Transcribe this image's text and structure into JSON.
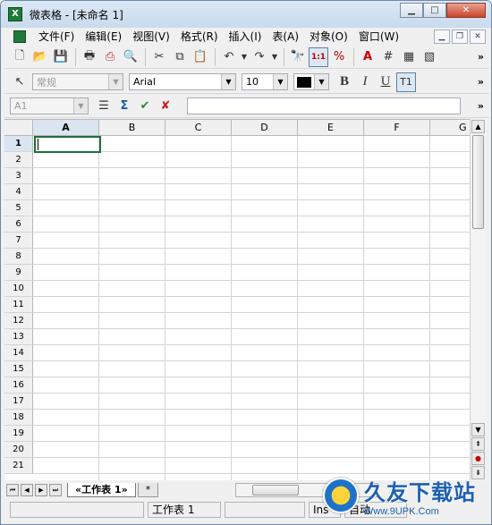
{
  "window": {
    "title": "微表格 - [未命名 1]"
  },
  "menu": [
    "文件(F)",
    "编辑(E)",
    "视图(V)",
    "格式(R)",
    "插入(I)",
    "表(A)",
    "对象(O)",
    "窗口(W)"
  ],
  "format_toolbar": {
    "style": "常规",
    "font": "Arial",
    "size": "10"
  },
  "formula_bar": {
    "cell_ref": "A1",
    "formula": ""
  },
  "columns": [
    "A",
    "B",
    "C",
    "D",
    "E",
    "F",
    "G"
  ],
  "rows": [
    "1",
    "2",
    "3",
    "4",
    "5",
    "6",
    "7",
    "8",
    "9",
    "10",
    "11",
    "12",
    "13",
    "14",
    "15",
    "16",
    "17",
    "18",
    "19",
    "20",
    "21"
  ],
  "sheets": {
    "active": "«工作表 1»",
    "add": "*"
  },
  "status": {
    "sheet": "工作表 1",
    "mode": "Ins",
    "zoom": "自动"
  },
  "watermark": {
    "text": "久友下载站",
    "url": "Www.9UPK.Com"
  },
  "colors": {
    "title_bg": "#c9dbee",
    "active_cell_border": "#1f6e3b",
    "header_bg": "#f0f0f0"
  }
}
